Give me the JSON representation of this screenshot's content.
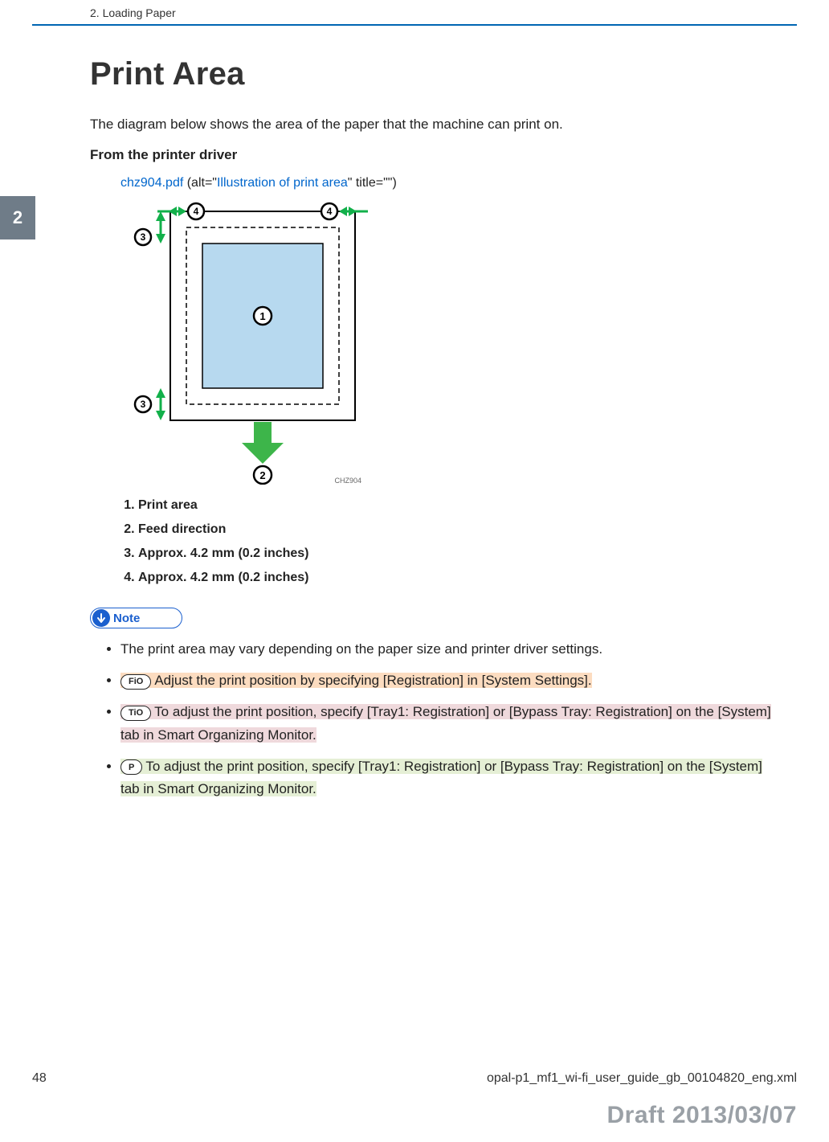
{
  "header": {
    "chapter": "2. Loading Paper",
    "tab": "2"
  },
  "title": "Print Area",
  "intro": "The diagram below shows the area of the paper that the machine can print on.",
  "subhead": "From the printer driver",
  "link": {
    "file": "chz904.pdf",
    "alt_prefix": " (alt=\"",
    "alt_text": "Illustration of print area",
    "alt_suffix": "\" title=\"\")"
  },
  "diagram": {
    "caption": "CHZ904",
    "callouts": {
      "c1": "1",
      "c2": "2",
      "c3": "3",
      "c4": "4"
    }
  },
  "legend": [
    "Print area",
    "Feed direction",
    "Approx. 4.2 mm (0.2 inches)",
    "Approx. 4.2 mm (0.2 inches)"
  ],
  "note": {
    "label": "Note",
    "items": [
      {
        "pill": null,
        "hl": null,
        "text": "The print area may vary depending on the paper size and printer driver settings."
      },
      {
        "pill": "FiO",
        "hl": "orange",
        "text": "Adjust the print position by specifying [Registration] in [System Settings]."
      },
      {
        "pill": "TiO",
        "hl": "pink",
        "text": "To adjust the print position, specify [Tray1: Registration] or [Bypass Tray: Registration] on the [System] tab in Smart Organizing Monitor."
      },
      {
        "pill": "P",
        "hl": "green",
        "text": "To adjust the print position, specify [Tray1: Registration] or [Bypass Tray: Registration] on the [System] tab in Smart Organizing Monitor."
      }
    ]
  },
  "footer": {
    "page": "48",
    "filename": "opal-p1_mf1_wi-fi_user_guide_gb_00104820_eng.xml",
    "draft": "Draft 2013/03/07"
  }
}
